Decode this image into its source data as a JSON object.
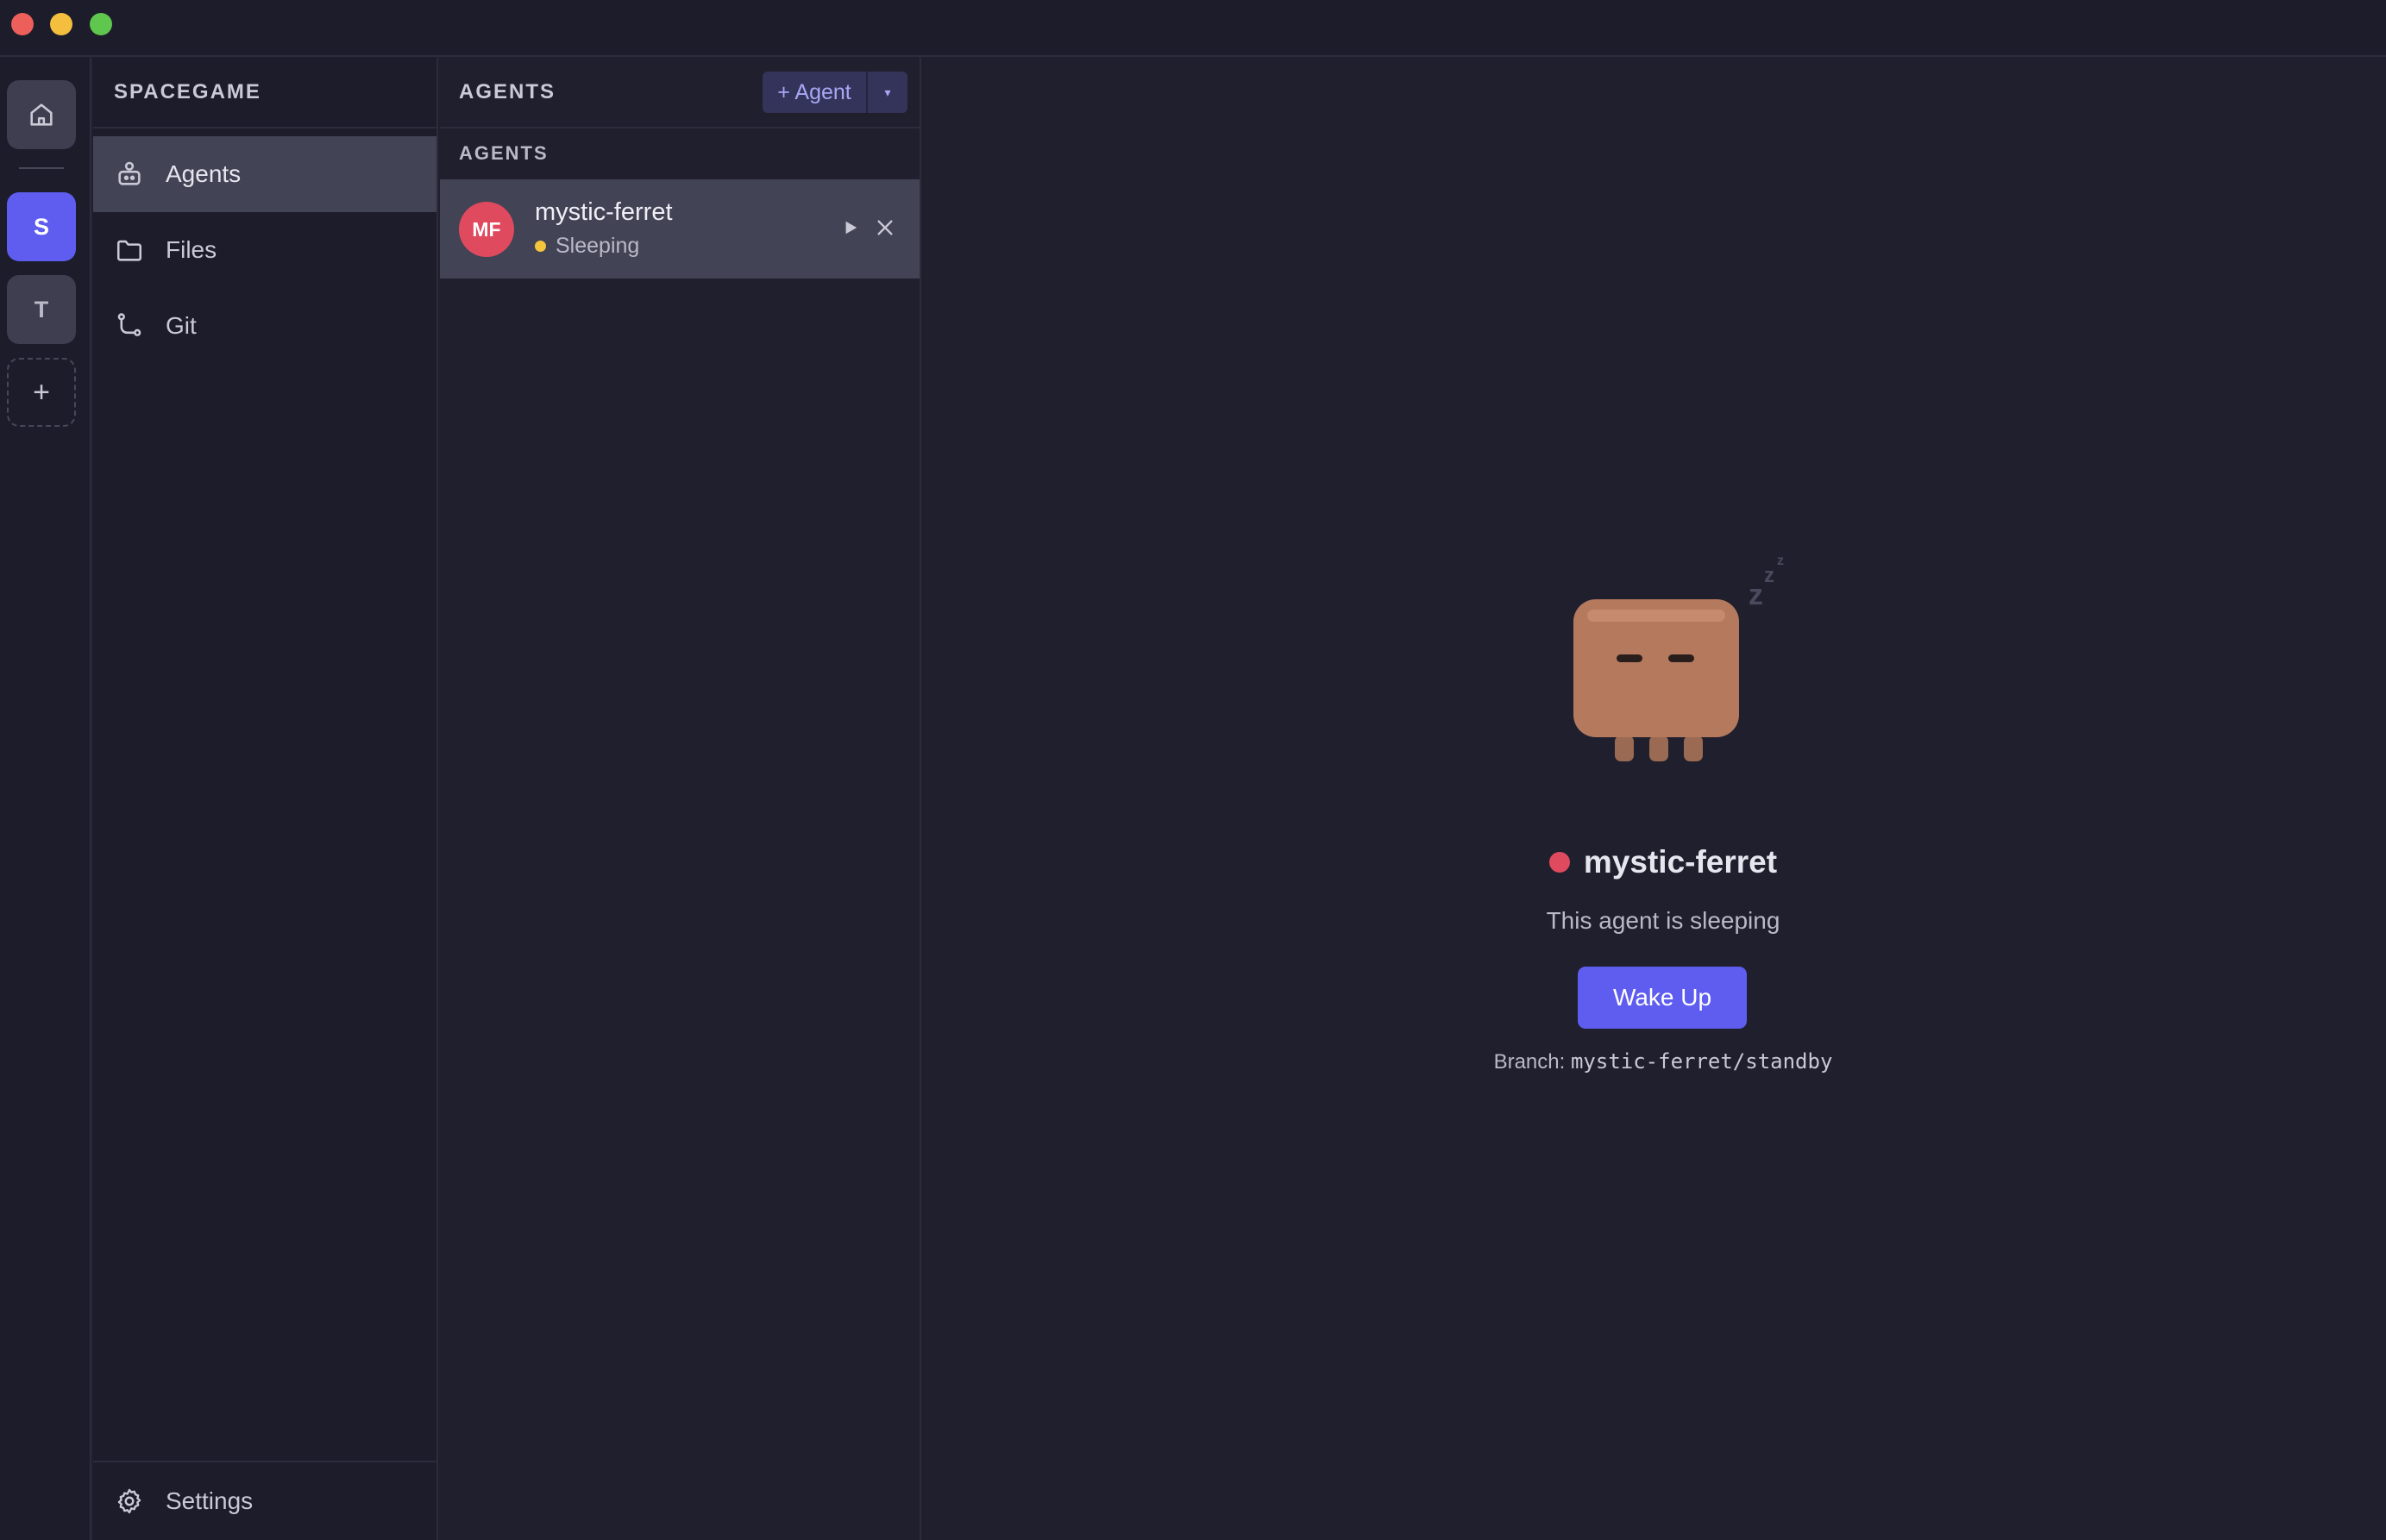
{
  "rail": {
    "workspaces": [
      {
        "initial": "S",
        "active": true
      },
      {
        "initial": "T",
        "active": false
      }
    ],
    "add_label": "+"
  },
  "sidebar": {
    "project_name": "SPACEGAME",
    "items": [
      {
        "label": "Agents",
        "icon": "agents-icon",
        "active": true
      },
      {
        "label": "Files",
        "icon": "folder-icon",
        "active": false
      },
      {
        "label": "Git",
        "icon": "git-branch-icon",
        "active": false
      }
    ],
    "settings_label": "Settings"
  },
  "agents_panel": {
    "title": "AGENTS",
    "add_button_label": "+ Agent",
    "section_label": "AGENTS",
    "agents": [
      {
        "initials": "MF",
        "name": "mystic-ferret",
        "status": "Sleeping",
        "status_color": "#f3c63c",
        "avatar_color": "#e04a5e"
      }
    ]
  },
  "detail": {
    "agent_name": "mystic-ferret",
    "message": "This agent is sleeping",
    "wake_button_label": "Wake Up",
    "branch_label": "Branch:",
    "branch_name": "mystic-ferret/standby",
    "sleep_symbol": "z"
  },
  "colors": {
    "accent": "#5f5df0",
    "agent_red": "#e04a5e",
    "sleeping_yellow": "#f3c63c",
    "mascot_body": "#b57a5e"
  }
}
